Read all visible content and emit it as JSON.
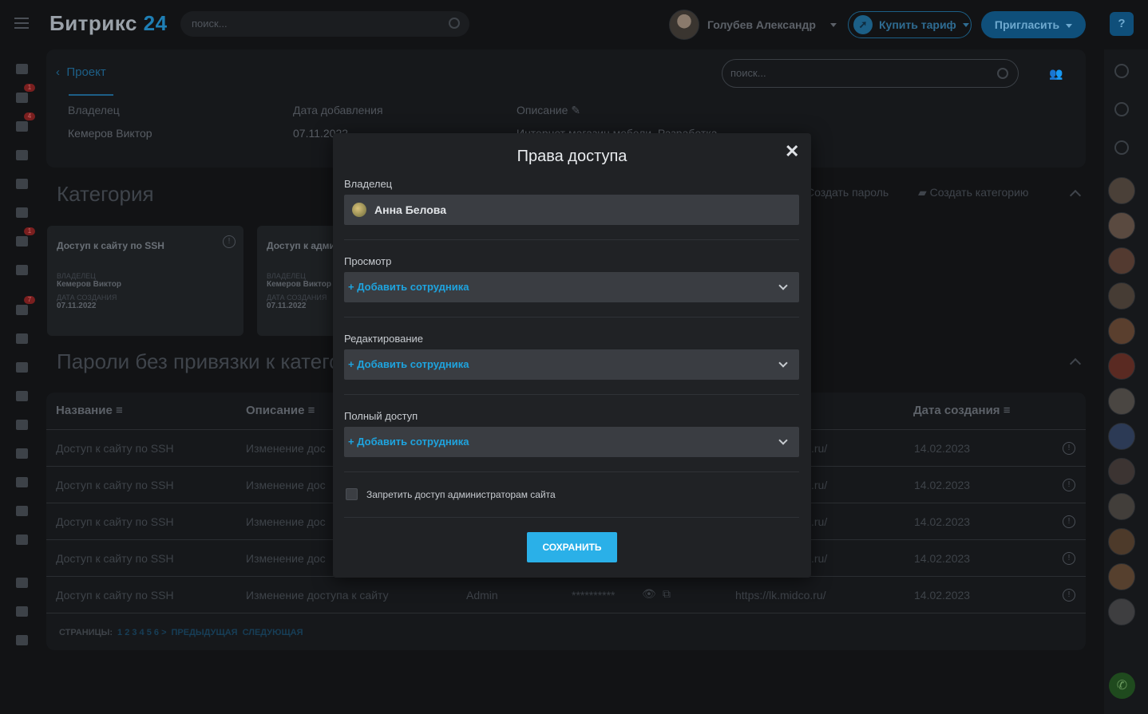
{
  "app": {
    "logo": "Битрикс",
    "logo_num": "24",
    "search_placeholder": "поиск..."
  },
  "header": {
    "user_name": "Голубев Александр",
    "buy_label": "Купить тариф",
    "invite_label": "Пригласить",
    "help": "?"
  },
  "leftbar": {
    "badges": [
      "1",
      "4",
      "1",
      "7"
    ]
  },
  "page": {
    "breadcrumb": "Проект",
    "search_placeholder": "поиск...",
    "owner_label": "Владелец",
    "owner_value": "Кемеров Виктор",
    "date_label": "Дата добавления",
    "date_value": "07.11.2022",
    "desc_label": "Описание",
    "desc_value": "Интернет магазин мебели. Разработка",
    "category_title": "Категория",
    "create_password": "Создать пароль",
    "create_category": "Создать категорию",
    "uncat_title": "Пароли без привязки к категории"
  },
  "categories": [
    {
      "title": "Доступ к сайту по SSH",
      "owner_k": "ВЛАДЕЛЕЦ",
      "owner_v": "Кемеров Виктор",
      "date_k": "ДАТА СОЗДАНИЯ",
      "date_v": "07.11.2022"
    },
    {
      "title": "Доступ к адми",
      "owner_k": "ВЛАДЕЛЕЦ",
      "owner_v": "Кемеров Виктор",
      "date_k": "ДАТА СОЗДАНИЯ",
      "date_v": "07.11.2022"
    }
  ],
  "table": {
    "headers": {
      "name": "Название",
      "desc": "Описание",
      "date": "Дата создания"
    },
    "rows": [
      {
        "name": "Доступ к сайту по SSH",
        "desc": "Изменение дос",
        "url": ".ru/",
        "date": "14.02.2023"
      },
      {
        "name": "Доступ к сайту по SSH",
        "desc": "Изменение дос",
        "url": ".ru/",
        "date": "14.02.2023"
      },
      {
        "name": "Доступ к сайту по SSH",
        "desc": "Изменение дос",
        "url": ".ru/",
        "date": "14.02.2023"
      },
      {
        "name": "Доступ к сайту по SSH",
        "desc": "Изменение дос",
        "url": ".ru/",
        "date": "14.02.2023"
      },
      {
        "name": "Доступ к сайту по SSH",
        "desc": "Изменение доступа к сайту",
        "login": "Admin",
        "pass": "**********",
        "url": "https://lk.midco.ru/",
        "date": "14.02.2023"
      }
    ],
    "pager_label": "СТРАНИЦЫ:",
    "pager_pages": "1 2 3 4 5 6 >",
    "pager_prev": "ПРЕДЫДУЩАЯ",
    "pager_next": "СЛЕДУЮЩАЯ"
  },
  "modal": {
    "title": "Права доступа",
    "close": "✕",
    "owner_label": "Владелец",
    "owner_name": "Анна Белова",
    "view_label": "Просмотр",
    "edit_label": "Редактирование",
    "full_label": "Полный доступ",
    "add_employee": "+ Добавить сотрудника",
    "deny_admins": "Запретить доступ администраторам сайта",
    "save": "СОХРАНИТЬ"
  },
  "colors": {
    "accent": "#2ab0e8",
    "link": "#1ea4df",
    "modal_bg": "#202225",
    "page_bg": "#121315"
  }
}
